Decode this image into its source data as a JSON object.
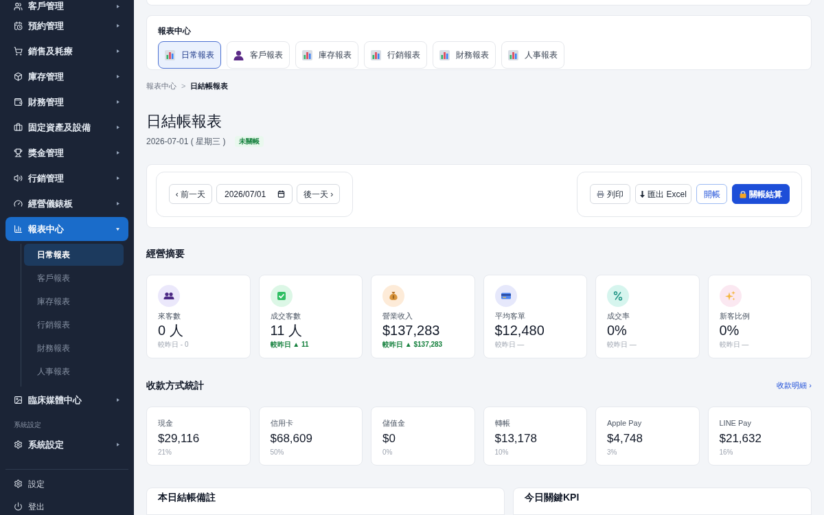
{
  "sidebar": {
    "groups": [
      {
        "items": [
          {
            "label": "客戶管理",
            "expanded": false,
            "selected": false
          },
          {
            "label": "預約管理",
            "expanded": false,
            "selected": false
          },
          {
            "label": "銷售及耗療",
            "expanded": false,
            "selected": false
          },
          {
            "label": "庫存管理",
            "expanded": false,
            "selected": false
          },
          {
            "label": "財務管理",
            "expanded": false,
            "selected": false
          },
          {
            "label": "固定資產及設備",
            "expanded": false,
            "selected": false
          },
          {
            "label": "獎金管理",
            "expanded": false,
            "selected": false
          },
          {
            "label": "行銷管理",
            "expanded": false,
            "selected": false
          },
          {
            "label": "經營儀錶板",
            "expanded": false,
            "selected": false
          },
          {
            "label": "報表中心",
            "expanded": true,
            "selected": true,
            "children": [
              {
                "label": "日常報表",
                "selected": true
              },
              {
                "label": "客戶報表",
                "selected": false
              },
              {
                "label": "庫存報表",
                "selected": false
              },
              {
                "label": "行銷報表",
                "selected": false
              },
              {
                "label": "財務報表",
                "selected": false
              },
              {
                "label": "人事報表",
                "selected": false
              }
            ]
          },
          {
            "label": "臨床媒體中心",
            "expanded": false,
            "selected": false
          }
        ]
      },
      {
        "heading": "系統設定",
        "items": [
          {
            "label": "系統設定",
            "expanded": false,
            "selected": false
          }
        ]
      }
    ],
    "footer": [
      {
        "label": "設定"
      },
      {
        "label": "登出"
      }
    ]
  },
  "report_center": {
    "title": "報表中心",
    "tabs": [
      {
        "label": "日常報表",
        "selected": true
      },
      {
        "label": "客戶報表",
        "selected": false
      },
      {
        "label": "庫存報表",
        "selected": false
      },
      {
        "label": "行銷報表",
        "selected": false
      },
      {
        "label": "財務報表",
        "selected": false
      },
      {
        "label": "人事報表",
        "selected": false
      }
    ]
  },
  "breadcrumb": {
    "items": [
      "報表中心",
      "日結帳報表"
    ],
    "separator": ">"
  },
  "page": {
    "title": "日結帳報表",
    "date": "2026-07-01 ( 星期三 )",
    "status": "未關帳",
    "closed": false
  },
  "toolbar": {
    "prev": "‹ 前一天",
    "date_value": "2026/07/01",
    "next": "後一天 ›",
    "actions": [
      {
        "label": "列印",
        "kind": "outline"
      },
      {
        "label": "匯出 Excel",
        "kind": "outline"
      },
      {
        "label": "開帳",
        "kind": "secondary"
      },
      {
        "label": "關帳結算",
        "kind": "primary"
      }
    ]
  },
  "summary": {
    "title": "經營摘要",
    "cards": [
      {
        "label": "來客數",
        "value": "0 人",
        "change": "較昨日 - 0",
        "increased": false
      },
      {
        "label": "成交客數",
        "value": "11 人",
        "change": "較昨日 ▲ 11",
        "increased": true
      },
      {
        "label": "營業收入",
        "value": "$137,283",
        "change": "較昨日 ▲ $137,283",
        "increased": true
      },
      {
        "label": "平均客單",
        "value": "$12,480",
        "change": "較昨日 —",
        "increased": false
      },
      {
        "label": "成交率",
        "value": "0%",
        "change": "較昨日 —",
        "increased": false
      },
      {
        "label": "新客比例",
        "value": "0%",
        "change": "較昨日 —",
        "increased": false
      }
    ]
  },
  "payments": {
    "title": "收款方式統計",
    "link": "收款明細 ›",
    "cards": [
      {
        "label": "現金",
        "amount": "$29,116",
        "share": "21%"
      },
      {
        "label": "信用卡",
        "amount": "$68,609",
        "share": "50%"
      },
      {
        "label": "儲值金",
        "amount": "$0",
        "share": "0%"
      },
      {
        "label": "轉帳",
        "amount": "$13,178",
        "share": "10%"
      },
      {
        "label": "Apple Pay",
        "amount": "$4,748",
        "share": "3%"
      },
      {
        "label": "LINE Pay",
        "amount": "$21,632",
        "share": "16%"
      }
    ]
  },
  "bottom_panels": [
    {
      "title": "本日結帳備註"
    },
    {
      "title": "今日關鍵KPI"
    }
  ]
}
